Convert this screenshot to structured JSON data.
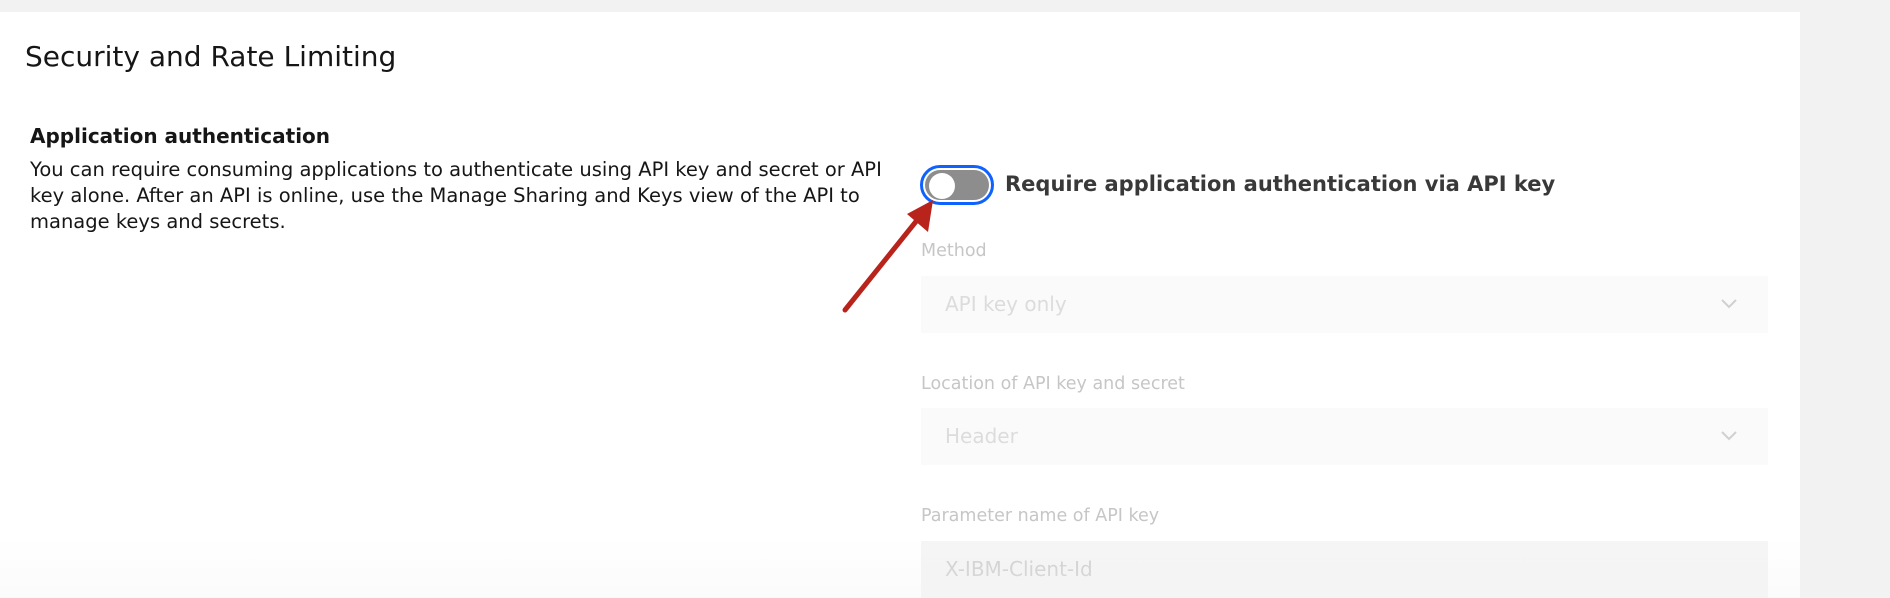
{
  "page": {
    "title": "Security and Rate Limiting"
  },
  "app_auth": {
    "heading": "Application authentication",
    "description": "You can require consuming applications to authenticate using API key and secret or API key alone. After an API is online, use the Manage Sharing and Keys view of the API to manage keys and secrets.",
    "toggle_label": "Require application authentication via API key",
    "toggle_state": "off"
  },
  "fields": {
    "method": {
      "label": "Method",
      "value": "API key only",
      "icon": "chevron-down-icon"
    },
    "location": {
      "label": "Location of API key and secret",
      "value": "Header",
      "icon": "chevron-down-icon"
    },
    "param_name": {
      "label": "Parameter name of API key",
      "value": "X-IBM-Client-Id"
    }
  },
  "colors": {
    "focus_ring": "#0f62fe",
    "toggle_off": "#8d8d8d",
    "annotation_arrow": "#b8231b"
  }
}
